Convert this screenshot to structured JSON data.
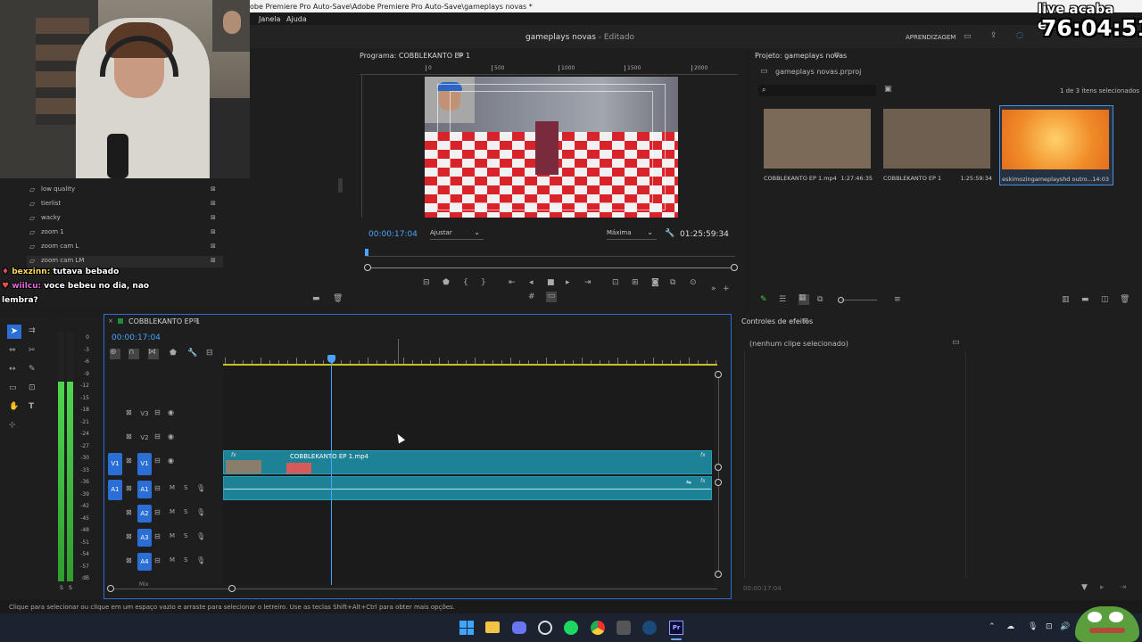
{
  "titlebar": {
    "path": "obe Premiere Pro Auto-Save\\Adobe Premiere Pro Auto-Save\\gameplays novas *",
    "menu": [
      "Janela",
      "Ajuda"
    ],
    "project": "gameplays novas",
    "project_state": "- Editado",
    "learning": "APRENDIZAGEM"
  },
  "overlay": {
    "live_label": "live acaba em:",
    "countdown": "76:04:51",
    "chat": [
      {
        "user": "bexzinn:",
        "msg": "tutava bebado"
      },
      {
        "user": "wiilcu:",
        "msg": "voce bebeu no dia, nao"
      },
      {
        "user": "",
        "msg": "lembra?"
      }
    ]
  },
  "left_panel": {
    "items": [
      "low quality",
      "tierlist",
      "wacky",
      "zoom 1",
      "zoom cam L",
      "zoom cam LM"
    ]
  },
  "program": {
    "title": "Programa: COBBLEKANTO EP 1",
    "ruler": [
      "0",
      "500",
      "1000",
      "1500",
      "2000"
    ],
    "timecode": "00:00:17:04",
    "fit": "Ajustar",
    "quality": "Máxima",
    "duration": "01:25:59:34"
  },
  "project": {
    "title": "Projeto: gameplays novas",
    "file": "gameplays novas.prproj",
    "selection": "1 de 3 itens selecionados",
    "items": [
      {
        "name": "COBBLEKANTO EP 1.mp4",
        "duration": "1:27:46:35"
      },
      {
        "name": "COBBLEKANTO EP 1",
        "duration": "1:25:59:34"
      },
      {
        "name": "eskimozingameplayshd outro...",
        "duration": "14:03"
      }
    ]
  },
  "timeline": {
    "title": "COBBLEKANTO EP 1",
    "timecode": "00:00:17:04",
    "video_tracks": [
      "V3",
      "V2",
      "V1"
    ],
    "audio_tracks": [
      "A1",
      "A2",
      "A3",
      "A4"
    ],
    "source_v": "V1",
    "source_a": "A1",
    "clip_name": "COBBLEKANTO EP 1.mp4",
    "mix": "Mix",
    "mute": "M",
    "solo": "S"
  },
  "meter": {
    "scale": [
      "0",
      "-3",
      "-6",
      "-9",
      "-12",
      "-15",
      "-18",
      "-21",
      "-24",
      "-27",
      "-30",
      "-33",
      "-36",
      "-39",
      "-42",
      "-45",
      "-48",
      "-51",
      "-54",
      "-57",
      "dB"
    ],
    "solo": [
      "S",
      "S"
    ]
  },
  "effects": {
    "title": "Controles de efeitos",
    "empty": "(nenhum clipe selecionado)",
    "timecode": "00:00:17:04"
  },
  "status": {
    "text": "Clique para selecionar ou clique em um espaço vazio e arraste para selecionar o letreiro. Use as teclas Shift+Alt+Ctrl para obter mais opções."
  },
  "colors": {
    "accent": "#2b6fd6",
    "clip": "#1e8297",
    "playhead": "#4aa3ff",
    "meter": "#3fbf3f",
    "taskbar": "#1b2331"
  }
}
